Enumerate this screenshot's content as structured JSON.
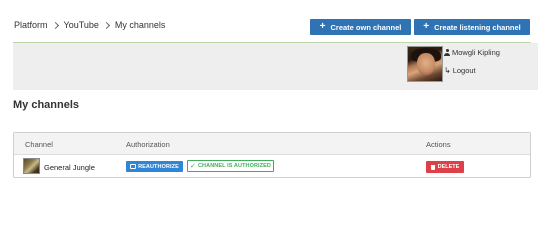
{
  "breadcrumb": {
    "items": [
      "Platform",
      "YouTube",
      "My channels"
    ]
  },
  "header": {
    "create_own_label": "Create own channel",
    "create_listening_label": "Create listening channel"
  },
  "user": {
    "name": "Mowgli Kipling",
    "logout_label": "Logout"
  },
  "page": {
    "title": "My channels"
  },
  "table": {
    "columns": [
      "Channel",
      "Authorization",
      "Actions"
    ],
    "rows": [
      {
        "channel": "General Jungle",
        "reauthorize_label": "REAUTHORIZE",
        "status_label": "CHANNEL IS AUTHORIZED",
        "delete_label": "DELETE"
      }
    ]
  },
  "colors": {
    "primary": "#2f73b4",
    "reauthorize": "#2f86d6",
    "authorized": "#3fae5a",
    "delete": "#df3f47"
  },
  "icons": [
    "plus-icon",
    "user-icon",
    "logout-icon",
    "monitor-icon",
    "check-icon",
    "trash-icon"
  ]
}
